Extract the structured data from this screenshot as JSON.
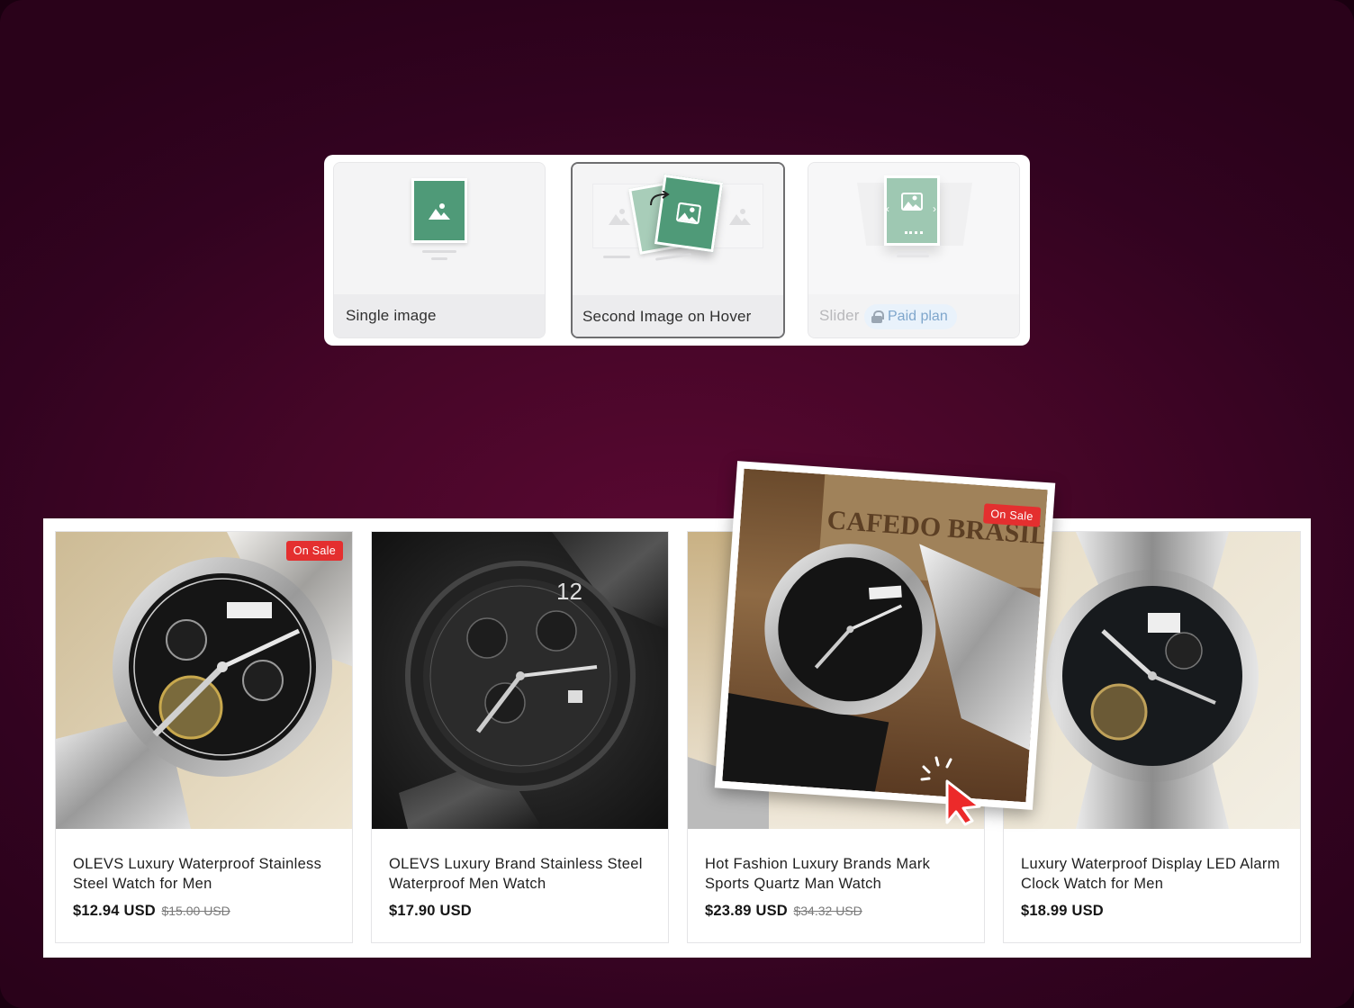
{
  "options": [
    {
      "label": "Single image",
      "selected": false,
      "locked": false
    },
    {
      "label": "Second Image on Hover",
      "selected": true,
      "locked": false
    },
    {
      "label": "Slider",
      "selected": false,
      "locked": true,
      "badge": "Paid plan"
    }
  ],
  "colors": {
    "background": "#470628",
    "accent_green": "#4f9a78",
    "sale_red": "#e42f2f",
    "paid_badge_bg": "#e9f2fb"
  },
  "products": [
    {
      "title": "OLEVS Luxury Waterproof Stainless Steel Watch for Men",
      "price": "$12.94 USD",
      "old_price": "$15.00 USD",
      "badge": "On Sale",
      "theme": "silver"
    },
    {
      "title": "OLEVS Luxury Brand Stainless Steel Waterproof Men Watch",
      "price": "$17.90 USD",
      "old_price": "",
      "badge": "",
      "theme": "black"
    },
    {
      "title": "Hot Fashion Luxury Brands Mark Sports Quartz Man Watch",
      "price": "$23.89 USD",
      "old_price": "$34.32 USD",
      "badge": "On Sale",
      "theme": "silver-dark"
    },
    {
      "title": "Luxury Waterproof Display LED Alarm Clock Watch for Men",
      "price": "$18.99 USD",
      "old_price": "",
      "badge": "",
      "theme": "silver"
    }
  ],
  "hover_preview": {
    "badge": "On Sale",
    "background_text": "CAFEDO BRASIL"
  },
  "icons": {
    "option_icon": "image-icon",
    "cursor": "click-cursor-icon",
    "lock": "lock-icon"
  }
}
